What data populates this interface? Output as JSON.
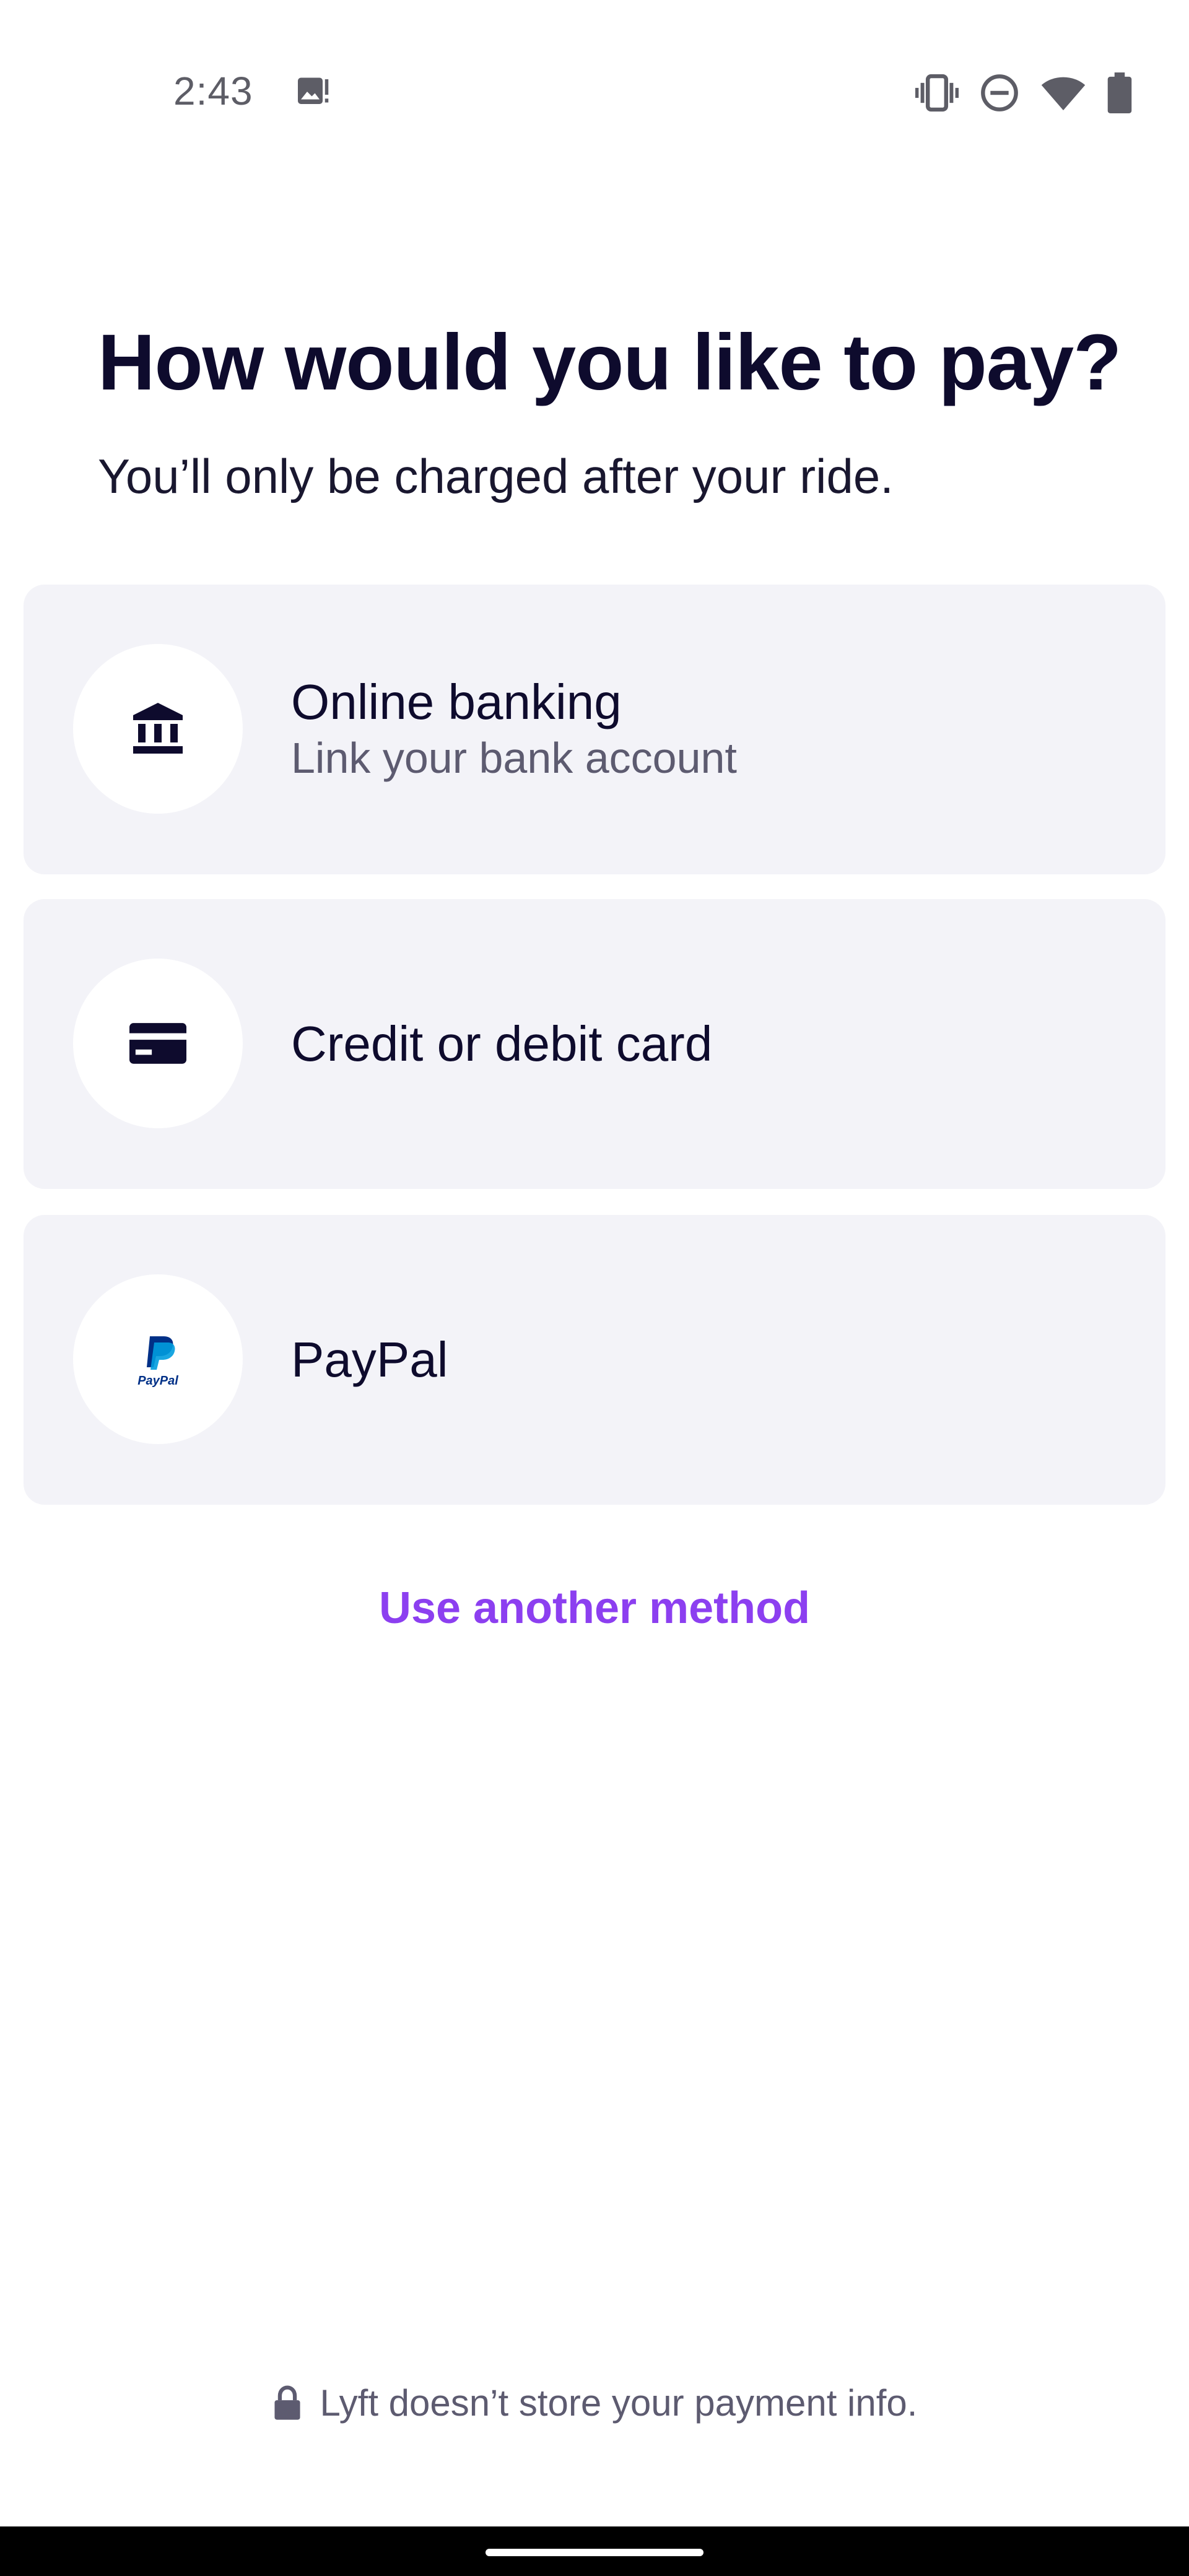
{
  "status_bar": {
    "time": "2:43",
    "icons": [
      "gallery-alert-icon",
      "vibrate-icon",
      "do-not-disturb-icon",
      "wifi-icon",
      "battery-icon"
    ]
  },
  "header": {
    "title": "How would you like to pay?",
    "subtitle": "You’ll only be charged after your ride."
  },
  "payment_options": [
    {
      "title": "Online banking",
      "subtitle": "Link your bank account",
      "icon": "bank-icon"
    },
    {
      "title": "Credit or debit card",
      "icon": "credit-card-icon"
    },
    {
      "title": "PayPal",
      "icon": "paypal-logo-icon",
      "logo_text": "PayPal"
    }
  ],
  "another_method": {
    "label": "Use another method"
  },
  "footer": {
    "note": "Lyft doesn’t store your payment info.",
    "icon": "lock-icon"
  },
  "colors": {
    "accent": "#8c3ff0",
    "text_primary": "#0e0b2d",
    "text_secondary": "#5d5b70",
    "card_background": "#f3f3f8",
    "paypal_dark_blue": "#003087",
    "paypal_light_blue": "#009cde"
  }
}
